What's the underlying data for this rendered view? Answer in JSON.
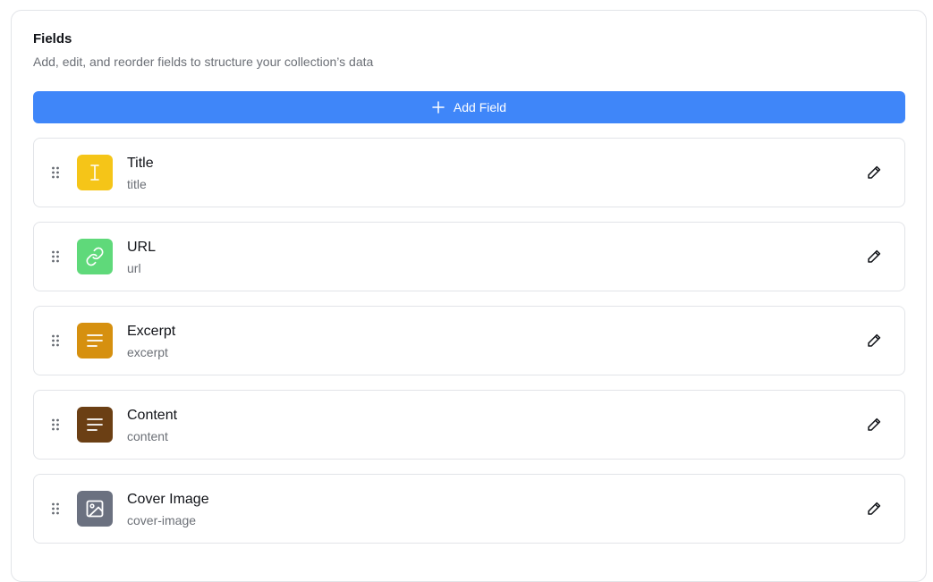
{
  "header": {
    "title": "Fields",
    "subtitle": "Add, edit, and reorder fields to structure your collection’s data"
  },
  "add_button": {
    "label": "Add Field",
    "icon": "plus-icon",
    "color": "#3f86f9"
  },
  "fields": [
    {
      "label": "Title",
      "key": "title",
      "icon": "text-cursor-icon",
      "color": "#f5c518"
    },
    {
      "label": "URL",
      "key": "url",
      "icon": "link-icon",
      "color": "#5fd97a"
    },
    {
      "label": "Excerpt",
      "key": "excerpt",
      "icon": "text-lines-icon",
      "color": "#d6900f"
    },
    {
      "label": "Content",
      "key": "content",
      "icon": "text-lines-icon",
      "color": "#6b3f14"
    },
    {
      "label": "Cover Image",
      "key": "cover-image",
      "icon": "image-icon",
      "color": "#6b7180"
    }
  ]
}
